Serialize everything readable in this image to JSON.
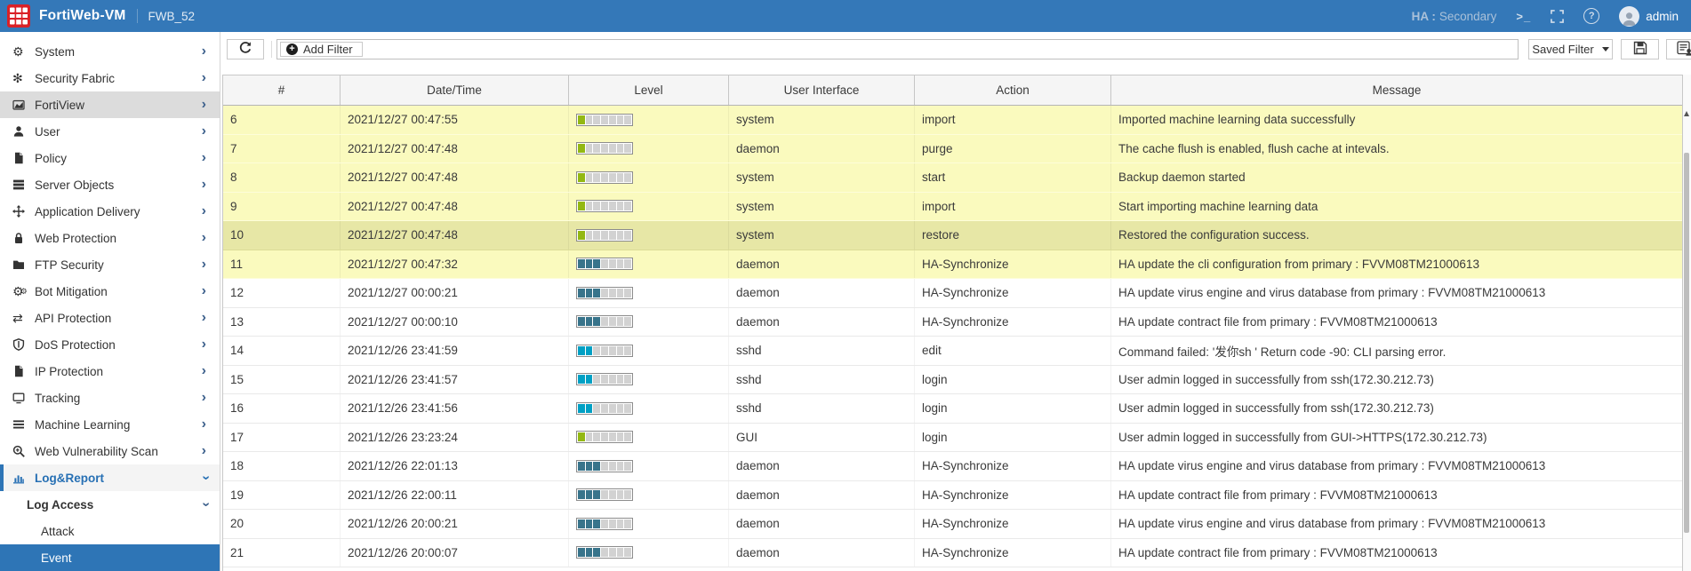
{
  "header": {
    "brand": "FortiWeb-VM",
    "device_name": "FWB_52",
    "ha_label": "HA :",
    "ha_status": "Secondary",
    "username": "admin",
    "icons": [
      "terminal-icon",
      "fullscreen-icon",
      "help-icon",
      "avatar"
    ]
  },
  "sidebar": {
    "items": [
      {
        "label": "System",
        "icon": "gear-icon",
        "chevron": "right"
      },
      {
        "label": "Security Fabric",
        "icon": "fabric-icon",
        "chevron": "right"
      },
      {
        "label": "FortiView",
        "icon": "area-chart-icon",
        "chevron": "right",
        "state": "highlighted"
      },
      {
        "label": "User",
        "icon": "user-icon",
        "chevron": "right"
      },
      {
        "label": "Policy",
        "icon": "page-icon",
        "chevron": "right"
      },
      {
        "label": "Server Objects",
        "icon": "server-icon",
        "chevron": "right"
      },
      {
        "label": "Application Delivery",
        "icon": "move-arrows-icon",
        "chevron": "right"
      },
      {
        "label": "Web Protection",
        "icon": "lock-icon",
        "chevron": "right"
      },
      {
        "label": "FTP Security",
        "icon": "folder-icon",
        "chevron": "right"
      },
      {
        "label": "Bot Mitigation",
        "icon": "gears-icon",
        "chevron": "right"
      },
      {
        "label": "API Protection",
        "icon": "exchange-icon",
        "chevron": "right"
      },
      {
        "label": "DoS Protection",
        "icon": "shield-icon",
        "chevron": "right"
      },
      {
        "label": "IP Protection",
        "icon": "page-icon",
        "chevron": "right"
      },
      {
        "label": "Tracking",
        "icon": "monitor-icon",
        "chevron": "right"
      },
      {
        "label": "Machine Learning",
        "icon": "list-icon",
        "chevron": "right"
      },
      {
        "label": "Web Vulnerability Scan",
        "icon": "search-plus-icon",
        "chevron": "right"
      },
      {
        "label": "Log&Report",
        "icon": "bar-chart-icon",
        "chevron": "down",
        "state": "active-section"
      },
      {
        "label": "Log Access",
        "type": "group",
        "chevron": "down"
      },
      {
        "label": "Attack",
        "type": "sub"
      },
      {
        "label": "Event",
        "type": "sub",
        "state": "selected"
      }
    ]
  },
  "toolbar": {
    "add_filter_label": "Add Filter",
    "saved_filter_label": "Saved Filter",
    "buttons": [
      {
        "name": "refresh-button",
        "icon": "refresh-icon"
      },
      {
        "name": "save-filter-button",
        "icon": "floppy-icon"
      },
      {
        "name": "log-details-button",
        "icon": "log-details-icon"
      }
    ]
  },
  "table": {
    "columns": [
      "#",
      "Date/Time",
      "Level",
      "User Interface",
      "Action",
      "Message"
    ],
    "level_colors": {
      "green": "#93b813",
      "cyan": "#00a0c4",
      "teal": "#38748b",
      "empty": "#d2d2d2"
    },
    "level_segments_total": 7,
    "rows": [
      {
        "id": "6",
        "datetime": "2021/12/27 00:47:55",
        "level": {
          "filled": 1,
          "color": "green"
        },
        "ui": "system",
        "action": "import",
        "message": "Imported machine learning data successfully",
        "highlight": "yellow"
      },
      {
        "id": "7",
        "datetime": "2021/12/27 00:47:48",
        "level": {
          "filled": 1,
          "color": "green"
        },
        "ui": "daemon",
        "action": "purge",
        "message": "The cache flush is enabled, flush cache at intevals.",
        "highlight": "yellow"
      },
      {
        "id": "8",
        "datetime": "2021/12/27 00:47:48",
        "level": {
          "filled": 1,
          "color": "green"
        },
        "ui": "system",
        "action": "start",
        "message": "Backup daemon started",
        "highlight": "yellow"
      },
      {
        "id": "9",
        "datetime": "2021/12/27 00:47:48",
        "level": {
          "filled": 1,
          "color": "green"
        },
        "ui": "system",
        "action": "import",
        "message": "Start importing machine learning data",
        "highlight": "yellow"
      },
      {
        "id": "10",
        "datetime": "2021/12/27 00:47:48",
        "level": {
          "filled": 1,
          "color": "green"
        },
        "ui": "system",
        "action": "restore",
        "message": "Restored the configuration success.",
        "highlight": "yellow-dark"
      },
      {
        "id": "11",
        "datetime": "2021/12/27 00:47:32",
        "level": {
          "filled": 3,
          "color": "teal"
        },
        "ui": "daemon",
        "action": "HA-Synchronize",
        "message": "HA update the cli configuration from primary : FVVM08TM21000613",
        "highlight": "yellow"
      },
      {
        "id": "12",
        "datetime": "2021/12/27 00:00:21",
        "level": {
          "filled": 3,
          "color": "teal"
        },
        "ui": "daemon",
        "action": "HA-Synchronize",
        "message": "HA update virus engine and virus database from primary : FVVM08TM21000613",
        "highlight": ""
      },
      {
        "id": "13",
        "datetime": "2021/12/27 00:00:10",
        "level": {
          "filled": 3,
          "color": "teal"
        },
        "ui": "daemon",
        "action": "HA-Synchronize",
        "message": "HA update contract file from primary : FVVM08TM21000613",
        "highlight": ""
      },
      {
        "id": "14",
        "datetime": "2021/12/26 23:41:59",
        "level": {
          "filled": 2,
          "color": "cyan"
        },
        "ui": "sshd",
        "action": "edit",
        "message": "Command failed: '发你sh ' Return code -90: CLI parsing error.",
        "highlight": ""
      },
      {
        "id": "15",
        "datetime": "2021/12/26 23:41:57",
        "level": {
          "filled": 2,
          "color": "cyan"
        },
        "ui": "sshd",
        "action": "login",
        "message": "User admin logged in successfully from ssh(172.30.212.73)",
        "highlight": ""
      },
      {
        "id": "16",
        "datetime": "2021/12/26 23:41:56",
        "level": {
          "filled": 2,
          "color": "cyan"
        },
        "ui": "sshd",
        "action": "login",
        "message": "User admin logged in successfully from ssh(172.30.212.73)",
        "highlight": ""
      },
      {
        "id": "17",
        "datetime": "2021/12/26 23:23:24",
        "level": {
          "filled": 1,
          "color": "green"
        },
        "ui": "GUI",
        "action": "login",
        "message": "User admin logged in successfully from GUI->HTTPS(172.30.212.73)",
        "highlight": ""
      },
      {
        "id": "18",
        "datetime": "2021/12/26 22:01:13",
        "level": {
          "filled": 3,
          "color": "teal"
        },
        "ui": "daemon",
        "action": "HA-Synchronize",
        "message": "HA update virus engine and virus database from primary : FVVM08TM21000613",
        "highlight": ""
      },
      {
        "id": "19",
        "datetime": "2021/12/26 22:00:11",
        "level": {
          "filled": 3,
          "color": "teal"
        },
        "ui": "daemon",
        "action": "HA-Synchronize",
        "message": "HA update contract file from primary : FVVM08TM21000613",
        "highlight": ""
      },
      {
        "id": "20",
        "datetime": "2021/12/26 20:00:21",
        "level": {
          "filled": 3,
          "color": "teal"
        },
        "ui": "daemon",
        "action": "HA-Synchronize",
        "message": "HA update virus engine and virus database from primary : FVVM08TM21000613",
        "highlight": ""
      },
      {
        "id": "21",
        "datetime": "2021/12/26 20:00:07",
        "level": {
          "filled": 3,
          "color": "teal"
        },
        "ui": "daemon",
        "action": "HA-Synchronize",
        "message": "HA update contract file from primary : FVVM08TM21000613",
        "highlight": ""
      }
    ]
  },
  "colors": {
    "topbar": "#3478b8",
    "logo_red": "#da2127",
    "accent_blue": "#2e75b6",
    "row_yellow": "#fafabe",
    "row_yellow_selected": "#e7e7a6"
  }
}
